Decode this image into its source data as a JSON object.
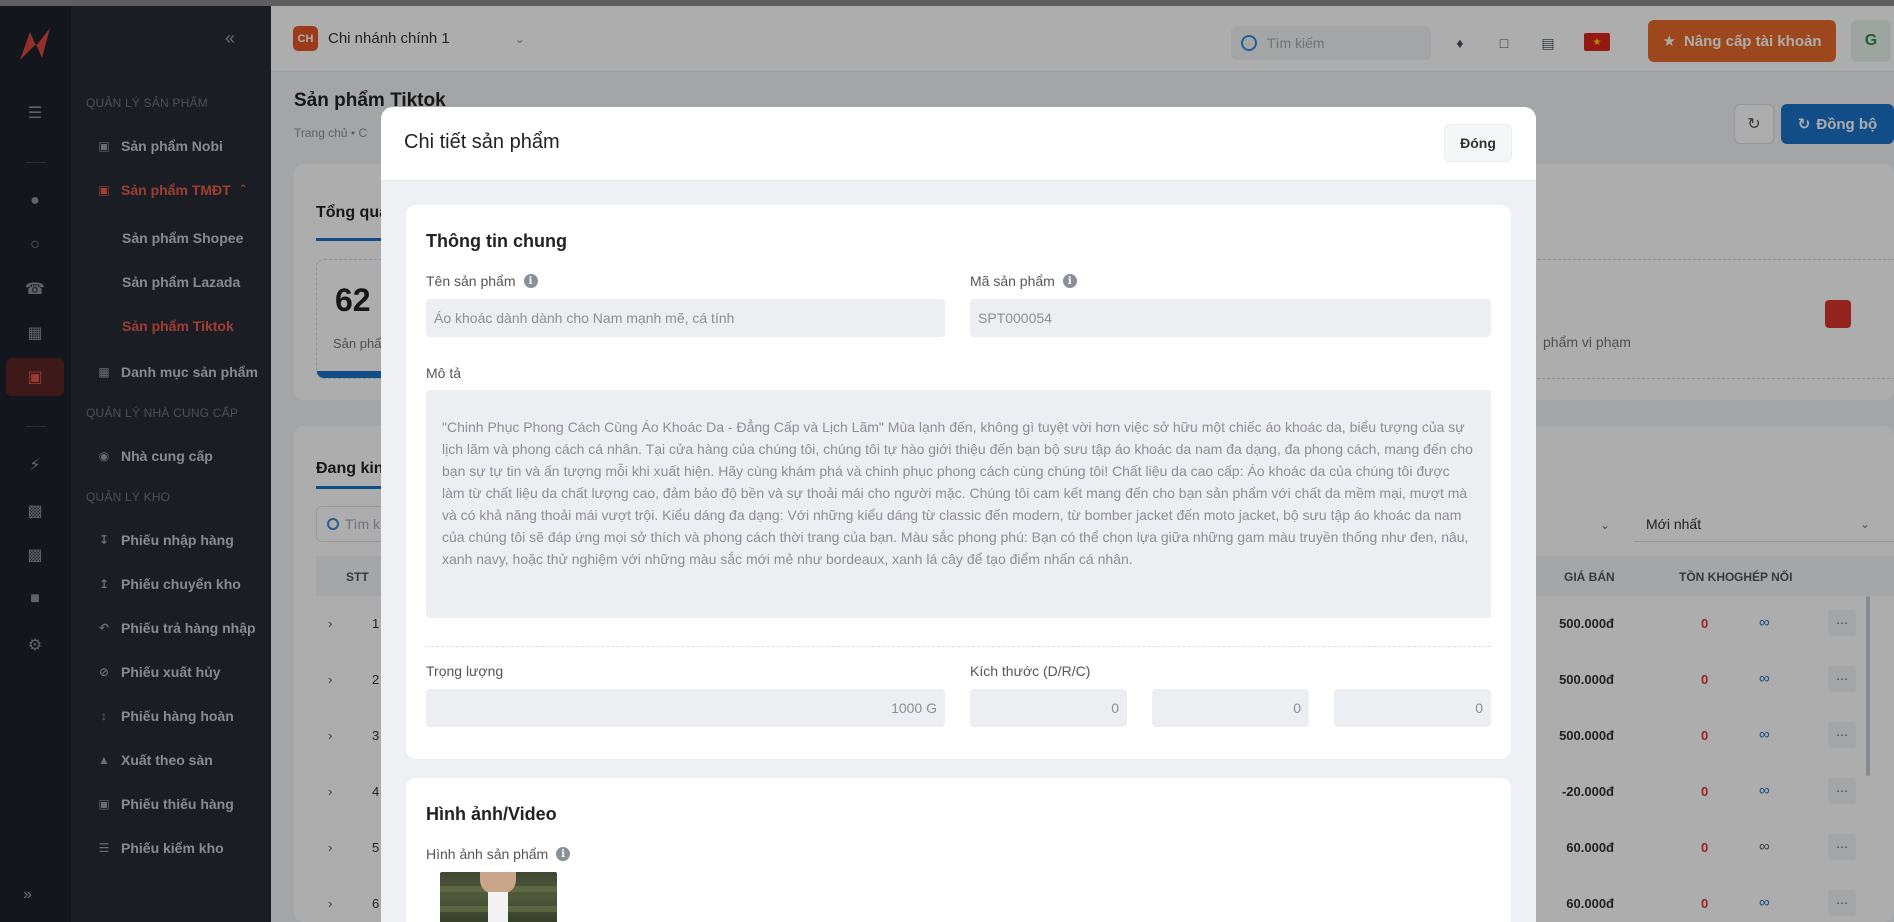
{
  "app": {
    "sidebar_groups": {
      "products": "QUẢN LÝ SẢN PHẨM",
      "suppliers": "QUẢN LÝ NHÀ CUNG CẤP",
      "warehouse": "QUẢN LÝ KHO"
    },
    "menu": {
      "nobi": "Sản phẩm Nobi",
      "tmdt": "Sản phẩm TMĐT",
      "shopee": "Sản phẩm Shopee",
      "lazada": "Sản phẩm Lazada",
      "tiktok": "Sản phẩm Tiktok",
      "category": "Danh mục sản phẩm",
      "supplier": "Nhà cung cấp",
      "import": "Phiếu nhập hàng",
      "transfer": "Phiếu chuyển kho",
      "return_import": "Phiếu trả hàng nhập",
      "dispose": "Phiếu xuất hủy",
      "refund": "Phiếu hàng hoàn",
      "export_floor": "Xuất theo sàn",
      "shortage": "Phiếu thiếu hàng",
      "inventory": "Phiếu kiểm kho"
    },
    "header": {
      "branch_badge": "CH",
      "branch_name": "Chi nhánh chính 1",
      "search_placeholder": "Tìm kiếm",
      "upgrade": "Nâng cấp tài khoản",
      "avatar": "G"
    },
    "page": {
      "title": "Sản phẩm Tiktok",
      "breadcrumb": "Trang chủ  •  C",
      "sync": "Đồng bộ"
    },
    "overview": {
      "tab": "Tổng qua",
      "count": "62",
      "count_label": "Sản phẩ",
      "violation_label": "phẩm vi phạm"
    },
    "listing": {
      "tab": "Đang kin",
      "search_placeholder": "Tìm k",
      "sort": "Mới nhất",
      "columns": {
        "stt": "STT",
        "price": "GIÁ BÁN",
        "stock": "TỒN KHO",
        "link": "GHÉP NỐI"
      },
      "rows": [
        {
          "stt": "1",
          "price": "500.000đ",
          "stock": "0"
        },
        {
          "stt": "2",
          "price": "500.000đ",
          "stock": "0"
        },
        {
          "stt": "3",
          "price": "500.000đ",
          "stock": "0"
        },
        {
          "stt": "4",
          "price": "-20.000đ",
          "stock": "0"
        },
        {
          "stt": "5",
          "price": "60.000đ",
          "stock": "0"
        },
        {
          "stt": "6",
          "price": "60.000đ",
          "stock": "0"
        }
      ]
    }
  },
  "modal": {
    "title": "Chi tiết sản phẩm",
    "close": "Đóng",
    "general": {
      "title": "Thông tin chung",
      "name_label": "Tên sản phẩm",
      "name_value": "Áo khoác dành dành cho Nam mạnh mẽ, cá tính",
      "code_label": "Mã sản phẩm",
      "code_value": "SPT000054",
      "desc_label": "Mô tả",
      "desc_value": "\"Chinh Phục Phong Cách Cùng Áo Khoác Da - Đẳng Cấp và Lịch Lãm\" Mùa lạnh đến, không gì tuyệt vời hơn việc sở hữu một chiếc áo khoác da, biểu tượng của sự lịch lãm và phong cách cá nhân. Tại cửa hàng của chúng tôi, chúng tôi tự hào giới thiệu đến bạn bộ sưu tập áo khoác da nam đa dạng, đa phong cách, mang đến cho bạn sự tự tin và ấn tượng mỗi khi xuất hiện. Hãy cùng khám phá và chinh phục phong cách cùng chúng tôi! Chất liệu da cao cấp: Áo khoác da của chúng tôi được làm từ chất liệu da chất lượng cao, đảm bảo độ bền và sự thoải mái cho người mặc. Chúng tôi cam kết mang đến cho bạn sản phẩm với chất da mềm mại, mượt mà và có khả năng thoải mái vượt trội. Kiểu dáng đa dạng: Với những kiểu dáng từ classic đến modern, từ bomber jacket đến moto jacket, bộ sưu tập áo khoác da nam của chúng tôi sẽ đáp ứng mọi sở thích và phong cách thời trang của bạn. Màu sắc phong phú: Bạn có thể chọn lựa giữa những gam màu truyền thống như đen, nâu, xanh navy, hoặc thử nghiệm với những màu sắc mới mẻ như bordeaux, xanh lá cây để tạo điểm nhấn cá nhân.",
      "weight_label": "Trọng lượng",
      "weight_value": "1000 G",
      "size_label": "Kích thước (D/R/C)",
      "size_d": "0",
      "size_r": "0",
      "size_c": "0"
    },
    "media": {
      "title": "Hình ảnh/Video",
      "images_label": "Hình ảnh sản phẩm"
    }
  }
}
